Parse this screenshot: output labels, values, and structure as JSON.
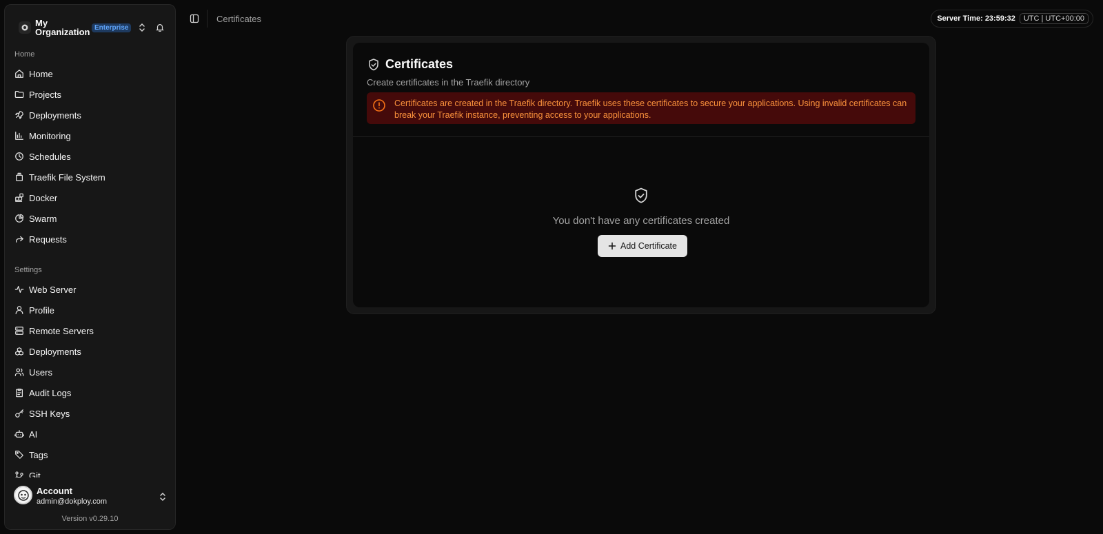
{
  "org": {
    "name": "My Organization",
    "badge": "Enterprise"
  },
  "sidebar": {
    "home_label": "Home",
    "home_items": [
      {
        "label": "Home",
        "icon": "house-icon"
      },
      {
        "label": "Projects",
        "icon": "folder-icon"
      },
      {
        "label": "Deployments",
        "icon": "rocket-icon"
      },
      {
        "label": "Monitoring",
        "icon": "chart-icon"
      },
      {
        "label": "Schedules",
        "icon": "clock-icon"
      },
      {
        "label": "Traefik File System",
        "icon": "file-stack-icon"
      },
      {
        "label": "Docker",
        "icon": "blocks-icon"
      },
      {
        "label": "Swarm",
        "icon": "pie-icon"
      },
      {
        "label": "Requests",
        "icon": "forward-icon"
      }
    ],
    "settings_label": "Settings",
    "settings_items": [
      {
        "label": "Web Server",
        "icon": "activity-icon"
      },
      {
        "label": "Profile",
        "icon": "user-icon"
      },
      {
        "label": "Remote Servers",
        "icon": "server-icon"
      },
      {
        "label": "Deployments",
        "icon": "boxes-icon"
      },
      {
        "label": "Users",
        "icon": "users-icon"
      },
      {
        "label": "Audit Logs",
        "icon": "clipboard-icon"
      },
      {
        "label": "SSH Keys",
        "icon": "key-icon"
      },
      {
        "label": "AI",
        "icon": "bot-icon"
      },
      {
        "label": "Tags",
        "icon": "tags-icon"
      },
      {
        "label": "Git",
        "icon": "git-icon"
      }
    ]
  },
  "account": {
    "name": "Account",
    "email": "admin@dokploy.com",
    "version": "Version v0.29.10"
  },
  "header": {
    "breadcrumb": "Certificates",
    "server_time": "Server Time: 23:59:32",
    "timezone": "UTC | UTC+00:00"
  },
  "main": {
    "title": "Certificates",
    "subtitle": "Create certificates in the Traefik directory",
    "alert": "Certificates are created in the Traefik directory. Traefik uses these certificates to secure your applications. Using invalid certificates can break your Traefik instance, preventing access to your applications.",
    "empty_text": "You don't have any certificates created",
    "add_button": "Add Certificate"
  },
  "colors": {
    "background": "#0a0a0a",
    "sidebar": "#171717",
    "alert_bg": "#450a0a",
    "alert_text": "#fb923c",
    "badge": "#60a5fa"
  }
}
